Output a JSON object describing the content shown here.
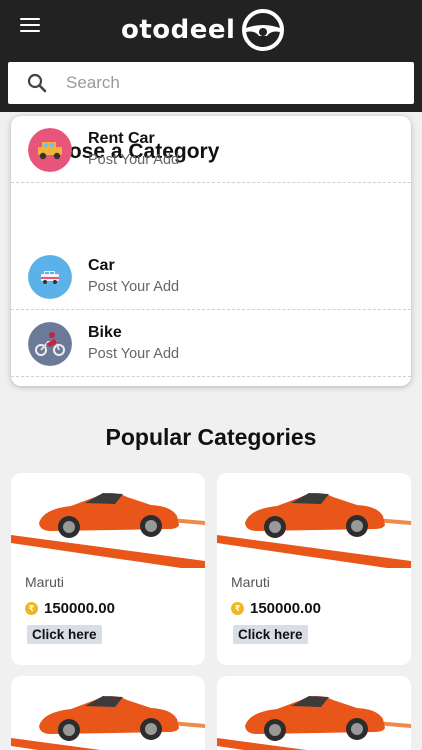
{
  "header": {
    "brand": "otodeel"
  },
  "search": {
    "placeholder": "Search",
    "value": ""
  },
  "category_section": {
    "title": "Choose a Category",
    "items": [
      {
        "name": "Car",
        "subtitle": "Post Your Add",
        "avatar_color": "#5bb2e8",
        "icon": "car-icon"
      },
      {
        "name": "Bike",
        "subtitle": "Post Your Add",
        "avatar_color": "#6b7a99",
        "icon": "motorbike-icon"
      },
      {
        "name": "Rent Car",
        "subtitle": "Post Your Add",
        "avatar_color": "#e8557a",
        "icon": "jeep-icon"
      }
    ]
  },
  "popular": {
    "title": "Popular Categories",
    "products": [
      {
        "name": "Maruti",
        "price": "150000.00",
        "button": "Click here"
      },
      {
        "name": "Maruti",
        "price": "150000.00",
        "button": "Click here"
      },
      {
        "name": "",
        "price": "",
        "button": ""
      },
      {
        "name": "",
        "price": "",
        "button": ""
      }
    ]
  },
  "colors": {
    "topbar": "#222222",
    "accent_orange": "#e8561a",
    "coin": "#f2b61f"
  }
}
